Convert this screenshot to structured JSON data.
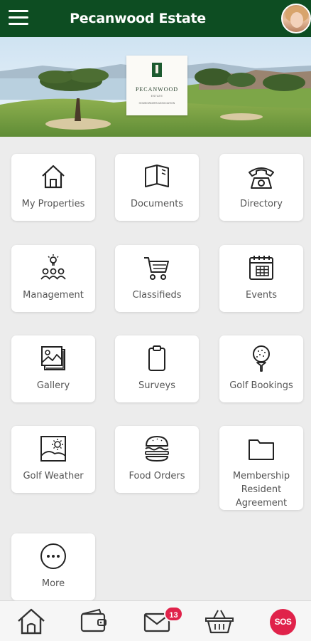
{
  "header": {
    "title": "Pecanwood Estate",
    "menu_icon": "hamburger-icon",
    "avatar": "user-avatar"
  },
  "banner": {
    "logo_name": "PECANWOOD",
    "logo_sub": "ESTATE",
    "logo_sub2": "HOMEOWNERS ASSOCIATION"
  },
  "tiles": [
    {
      "label": "My Properties",
      "icon": "house-icon"
    },
    {
      "label": "Documents",
      "icon": "open-book-icon"
    },
    {
      "label": "Directory",
      "icon": "telephone-icon"
    },
    {
      "label": "Management",
      "icon": "team-idea-icon"
    },
    {
      "label": "Classifieds",
      "icon": "shopping-cart-icon"
    },
    {
      "label": "Events",
      "icon": "calendar-icon"
    },
    {
      "label": "Gallery",
      "icon": "photo-gallery-icon"
    },
    {
      "label": "Surveys",
      "icon": "clipboard-icon"
    },
    {
      "label": "Golf Bookings",
      "icon": "golf-ball-tee-icon"
    },
    {
      "label": "Golf Weather",
      "icon": "weather-picture-icon"
    },
    {
      "label": "Food Orders",
      "icon": "burger-icon"
    },
    {
      "label": "Membership Resident Agreement",
      "icon": "folder-icon"
    },
    {
      "label": "More",
      "icon": "more-dots-icon"
    }
  ],
  "bottom_nav": {
    "home": "home-icon",
    "wallet": "wallet-icon",
    "messages": "envelope-icon",
    "messages_badge": "13",
    "basket": "basket-icon",
    "sos_label": "SOS"
  },
  "colors": {
    "header_bg": "#0d4d22",
    "badge": "#e0224a",
    "background": "#ececec"
  }
}
